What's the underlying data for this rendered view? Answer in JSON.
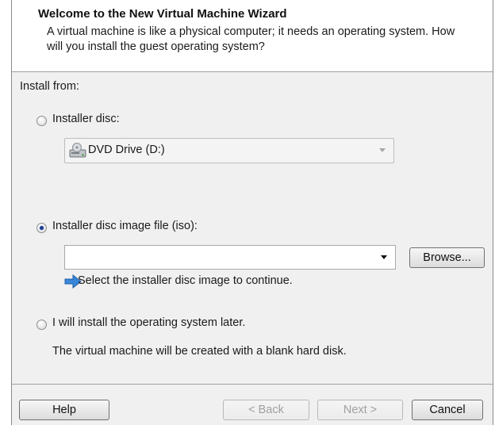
{
  "header": {
    "title": "Welcome to the New Virtual Machine Wizard",
    "subtitle": "A virtual machine is like a physical computer; it needs an operating system. How will you install the guest operating system?"
  },
  "install_from": {
    "label": "Install from:",
    "installer_disc": {
      "label": "Installer disc:",
      "selected": false,
      "drive_value": "DVD Drive (D:)",
      "enabled": false
    },
    "iso": {
      "label": "Installer disc image file (iso):",
      "selected": true,
      "path_value": "",
      "browse_label": "Browse...",
      "hint": "Select the installer disc image to continue."
    },
    "later": {
      "label": "I will install the operating system later.",
      "selected": false,
      "description": "The virtual machine will be created with a blank hard disk."
    }
  },
  "footer": {
    "help_label": "Help",
    "back_label": "< Back",
    "next_label": "Next >",
    "cancel_label": "Cancel"
  },
  "icons": {
    "drive": "optical-drive-icon",
    "hint": "arrow-right-icon"
  },
  "colors": {
    "header_bg": "#ffffff",
    "body_bg": "#f0f0f0",
    "hint_arrow": "#3a86d8"
  }
}
